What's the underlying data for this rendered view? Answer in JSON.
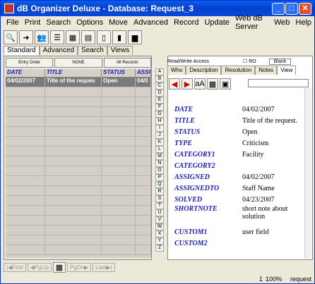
{
  "window": {
    "title": "dB Organizer Deluxe - Database: Request_3"
  },
  "menu": [
    "File",
    "Print",
    "Search",
    "Options",
    "Move",
    "Advanced",
    "Record",
    "Update",
    "Web dB Server",
    "Web",
    "Help"
  ],
  "left_tabs": [
    "Standard",
    "Advanced",
    "Search",
    "Views"
  ],
  "left_buttons": [
    "Entry Order",
    "NONE",
    "All Records"
  ],
  "grid": {
    "headers": [
      "DATE",
      "TITLE",
      "STATUS",
      "ASSI"
    ],
    "rows": [
      [
        "04/02/2007",
        "Title of the reques",
        "Open",
        "04/0"
      ]
    ]
  },
  "nav": [
    "First",
    "PgUp",
    "PgDn",
    "Last"
  ],
  "right_header": {
    "mode": "Read/Write Access",
    "ro": "RO",
    "blank": "Blank"
  },
  "right_tabs": [
    "Who",
    "Description",
    "Resolution",
    "Notes",
    "View"
  ],
  "alphabet": [
    "A",
    "B",
    "C",
    "D",
    "E",
    "F",
    "G",
    "H",
    "I",
    "J",
    "K",
    "L",
    "M",
    "N",
    "O",
    "P",
    "Q",
    "R",
    "S",
    "T",
    "U",
    "V",
    "W",
    "X",
    "Y",
    "Z"
  ],
  "fields": [
    {
      "name": "DATE",
      "value": "04/02/2007"
    },
    {
      "name": "TITLE",
      "value": "Title of the request."
    },
    {
      "name": "STATUS",
      "value": "Open"
    },
    {
      "name": "TYPE",
      "value": "Criticism"
    },
    {
      "name": "CATEGORY1",
      "value": "Facility"
    },
    {
      "name": "CATEGORY2",
      "value": ""
    },
    {
      "name": "ASSIGNED",
      "value": "04/02/2007"
    },
    {
      "name": "ASSIGNEDTO",
      "value": "Staff Name"
    },
    {
      "name": "SOLVED",
      "value": "04/23/2007"
    },
    {
      "name": "SHORTNOTE",
      "value": "short note about solution"
    },
    {
      "name": "CUSTOM1",
      "value": "user field"
    },
    {
      "name": "CUSTOM2",
      "value": ""
    }
  ],
  "status": {
    "count": "1",
    "zoom": "100%",
    "label": "request"
  }
}
